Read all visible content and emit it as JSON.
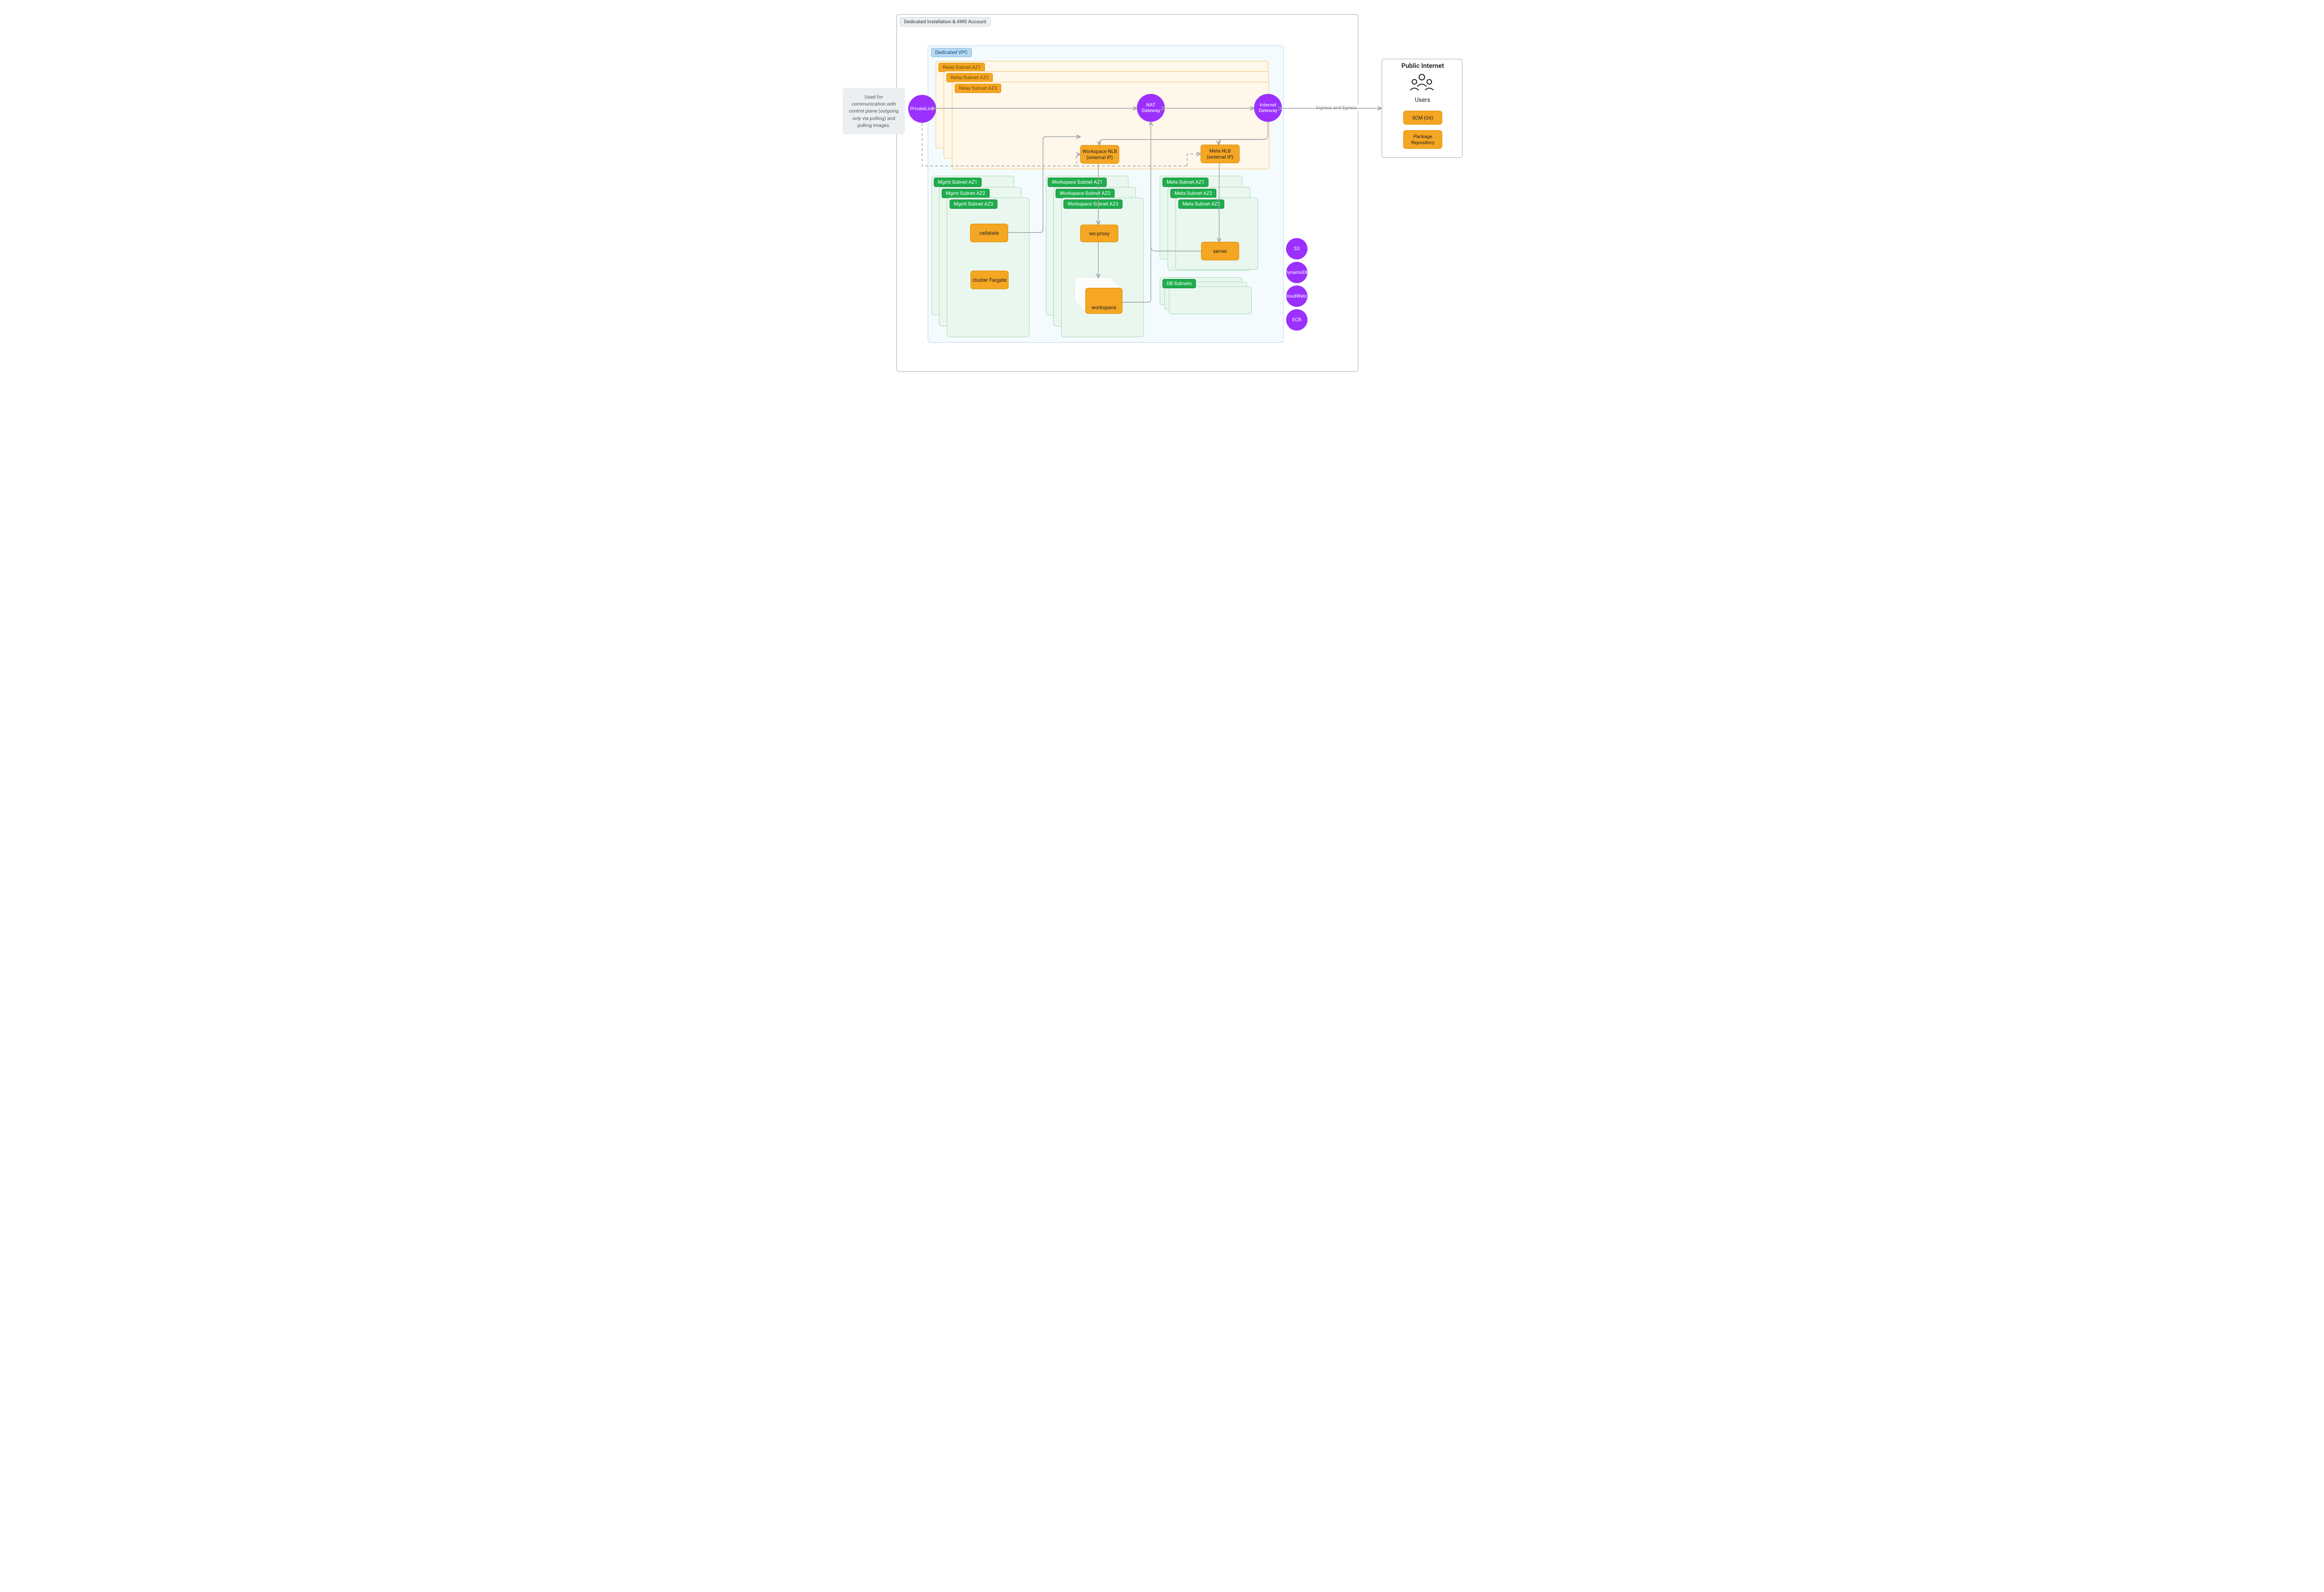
{
  "outer": {
    "title": "Dedicated Installation & AWS Account"
  },
  "vpc": {
    "title": "Dedicated VPC"
  },
  "relay": {
    "az1": "Relay Subnet AZ1",
    "az2": "Relay Subnet AZ2",
    "az3": "Relay Subnet AZ3"
  },
  "mgmt": {
    "az1": "Mgmt Subnet AZ1",
    "az2": "Mgmt Subnet AZ2",
    "az3": "Mgmt Subnet AZ3"
  },
  "ws": {
    "az1": "Workspace Subnet AZ1",
    "az2": "Workspace Subnet AZ2",
    "az3": "Workspace Subnet AZ3"
  },
  "meta": {
    "az1": "Meta Subnet AZ1",
    "az2": "Meta Subnet AZ2",
    "az3": "Meta Subnet AZ3"
  },
  "db": {
    "label": "DB Subnets"
  },
  "services": {
    "ws_nlb": "Workspace NLB (external IP)",
    "meta_nlb": "Meta NLB (external IP)",
    "cellstate": "cellstate",
    "cluster_fargate": "cluster Fargate",
    "ws_proxy": "ws-proxy",
    "workspace": "workspace",
    "server": "server"
  },
  "circles": {
    "privatelink": "PrivateLink",
    "nat": "NAT Gateway",
    "igw": "Internet Gateway",
    "s3": "S3",
    "ddb": "DynamoDB",
    "cw": "CloudWatch",
    "ecr": "ECR"
  },
  "note": {
    "line1": "Used for communication with control plane (",
    "em": "outgoing only",
    "line2": " via polling) and pulling images."
  },
  "public": {
    "title": "Public Internet",
    "users": "Users",
    "scm": "SCM (Git)",
    "pkg": "Package Repository"
  },
  "conn": {
    "ingress_egress": "Ingress and Egress"
  }
}
